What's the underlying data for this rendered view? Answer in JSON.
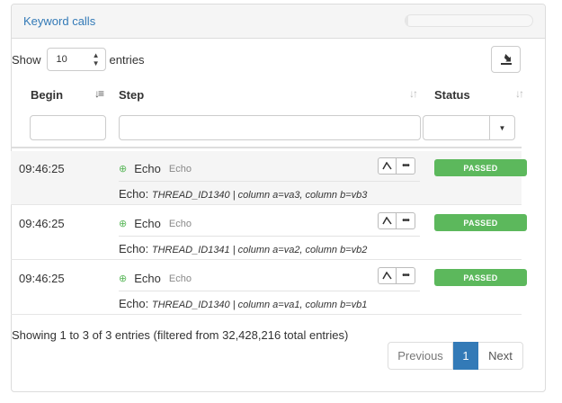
{
  "panel": {
    "title": "Keyword calls",
    "progress_fraction": 0.02
  },
  "length_menu": {
    "show_label": "Show",
    "value": "10",
    "entries_label": "entries"
  },
  "columns": {
    "begin": "Begin",
    "step": "Step",
    "status": "Status"
  },
  "filters": {
    "begin": "",
    "step": "",
    "status": ""
  },
  "rows": [
    {
      "begin": "09:46:25",
      "keyword": "Echo",
      "library": "Echo",
      "status": "PASSED",
      "message_prefix": "Echo: ",
      "message_args": "THREAD_ID1340 | column a=va3, column b=vb3"
    },
    {
      "begin": "09:46:25",
      "keyword": "Echo",
      "library": "Echo",
      "status": "PASSED",
      "message_prefix": "Echo: ",
      "message_args": "THREAD_ID1341 | column a=va2, column b=vb2"
    },
    {
      "begin": "09:46:25",
      "keyword": "Echo",
      "library": "Echo",
      "status": "PASSED",
      "message_prefix": "Echo: ",
      "message_args": "THREAD_ID1340 | column a=va1, column b=vb1"
    }
  ],
  "info_text": "Showing 1 to 3 of 3 entries (filtered from 32,428,216 total entries)",
  "pagination": {
    "previous": "Previous",
    "current": "1",
    "next": "Next"
  },
  "colors": {
    "accent": "#337ab7",
    "passed": "#5cb85c"
  },
  "icons": {
    "export": "export-icon",
    "zoom": "zoom-in-icon",
    "graph": "graph-icon",
    "more": "ellipsis-icon",
    "sort": "sort-icon",
    "caret": "caret-down-icon"
  }
}
